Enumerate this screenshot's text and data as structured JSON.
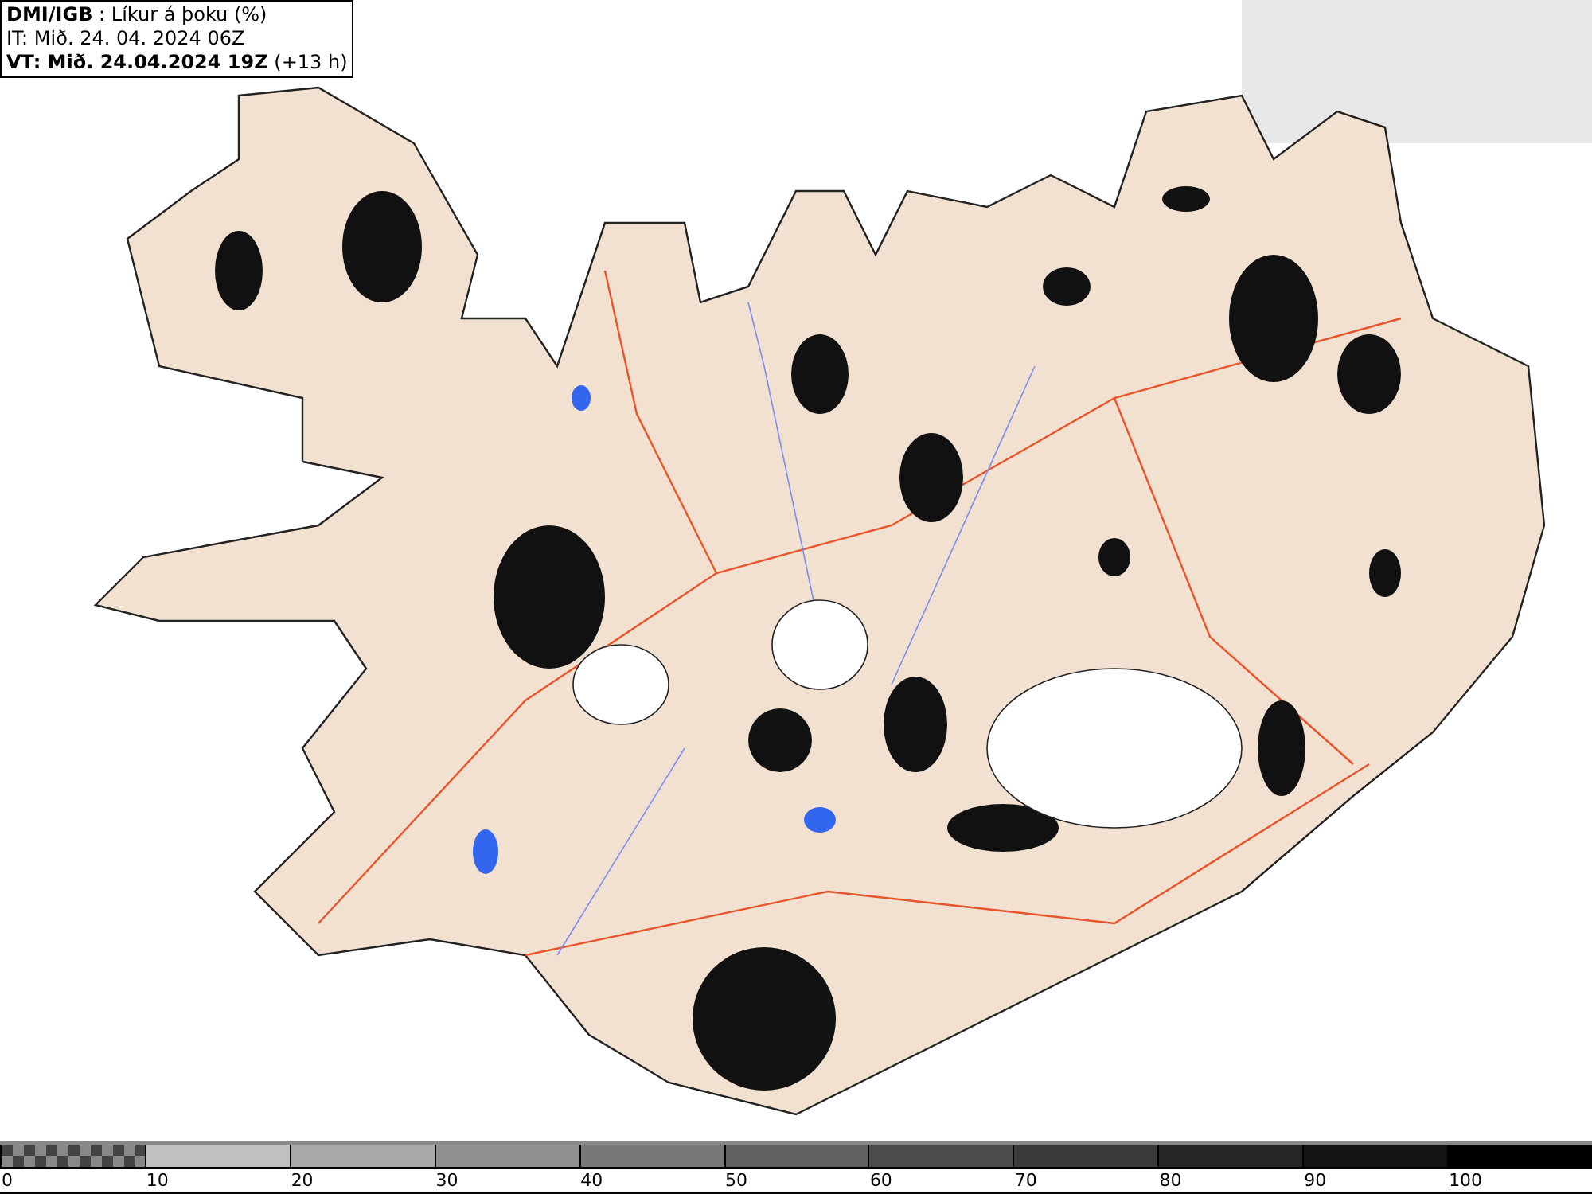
{
  "info_box": {
    "lines": [
      "**DMI/IGB** : Líkur á þoku (%)",
      "IT: Mið. 24. 04. 2024 06Z",
      "**VT: Mið. 24.04.2024 19Z** (+13 h)"
    ]
  },
  "legend": [
    {
      "kind": "checkered",
      "color": "#444444",
      "label": "0"
    },
    {
      "kind": "solid",
      "color": "#c0c0c0",
      "label": "10"
    },
    {
      "kind": "solid",
      "color": "#a8a8a8",
      "label": "20"
    },
    {
      "kind": "solid",
      "color": "#909090",
      "label": "30"
    },
    {
      "kind": "solid",
      "color": "#787878",
      "label": "40"
    },
    {
      "kind": "solid",
      "color": "#606060",
      "label": "50"
    },
    {
      "kind": "solid",
      "color": "#4c4c4c",
      "label": "60"
    },
    {
      "kind": "solid",
      "color": "#3a3a3a",
      "label": "70"
    },
    {
      "kind": "solid",
      "color": "#262626",
      "label": "80"
    },
    {
      "kind": "solid",
      "color": "#141414",
      "label": "90"
    },
    {
      "kind": "solid",
      "color": "#000000",
      "label": "100"
    }
  ]
}
